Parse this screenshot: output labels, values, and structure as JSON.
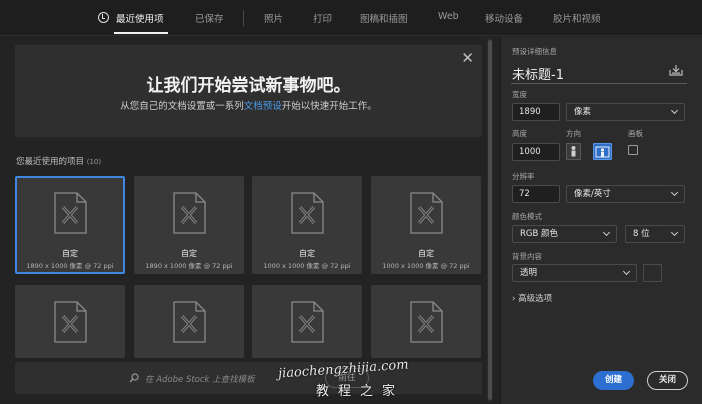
{
  "tabs": [
    {
      "label": "最近使用项",
      "active": true
    },
    {
      "label": "已保存"
    },
    {
      "label": "照片"
    },
    {
      "label": "打印"
    },
    {
      "label": "图稿和插图"
    },
    {
      "label": "Web"
    },
    {
      "label": "移动设备"
    },
    {
      "label": "胶片和视频"
    }
  ],
  "hero": {
    "title": "让我们开始尝试新事物吧。",
    "sub_before": "从您自己的文档设置或一系列",
    "sub_link": "文档预设",
    "sub_after": "开始以快速开始工作。"
  },
  "recent": {
    "label": "您最近使用的项目",
    "count": "(10)",
    "items": [
      {
        "name": "自定",
        "meta": "1890 x 1000 像素 @ 72 ppi"
      },
      {
        "name": "自定",
        "meta": "1890 x 1000 像素 @ 72 ppi"
      },
      {
        "name": "自定",
        "meta": "1000 x 1000 像素 @ 72 ppi"
      },
      {
        "name": "自定",
        "meta": "1000 x 1000 像素 @ 72 ppi"
      }
    ]
  },
  "stock": {
    "placeholder": "在 Adobe Stock 上查找模板",
    "go_label": "前往"
  },
  "watermark": {
    "line1": "jiaochengzhijia.com",
    "line2": "教程之家"
  },
  "panel": {
    "preset_details_label": "预设详细信息",
    "doc_title": "未标题-1",
    "width_label": "宽度",
    "width_value": "1890",
    "width_unit": "像素",
    "height_label": "高度",
    "height_value": "1000",
    "orientation_label": "方向",
    "artboard_label": "画板",
    "resolution_label": "分辨率",
    "resolution_value": "72",
    "resolution_unit": "像素/英寸",
    "color_mode_label": "颜色模式",
    "color_mode_value": "RGB 颜色",
    "bit_depth_value": "8 位",
    "background_label": "背景内容",
    "background_value": "透明",
    "advanced_label": "高级选项",
    "create_label": "创建",
    "close_label": "关闭"
  },
  "colors": {
    "accent": "#2c6fd0",
    "link": "#4a9bea",
    "selected_border": "#3f86e0"
  }
}
